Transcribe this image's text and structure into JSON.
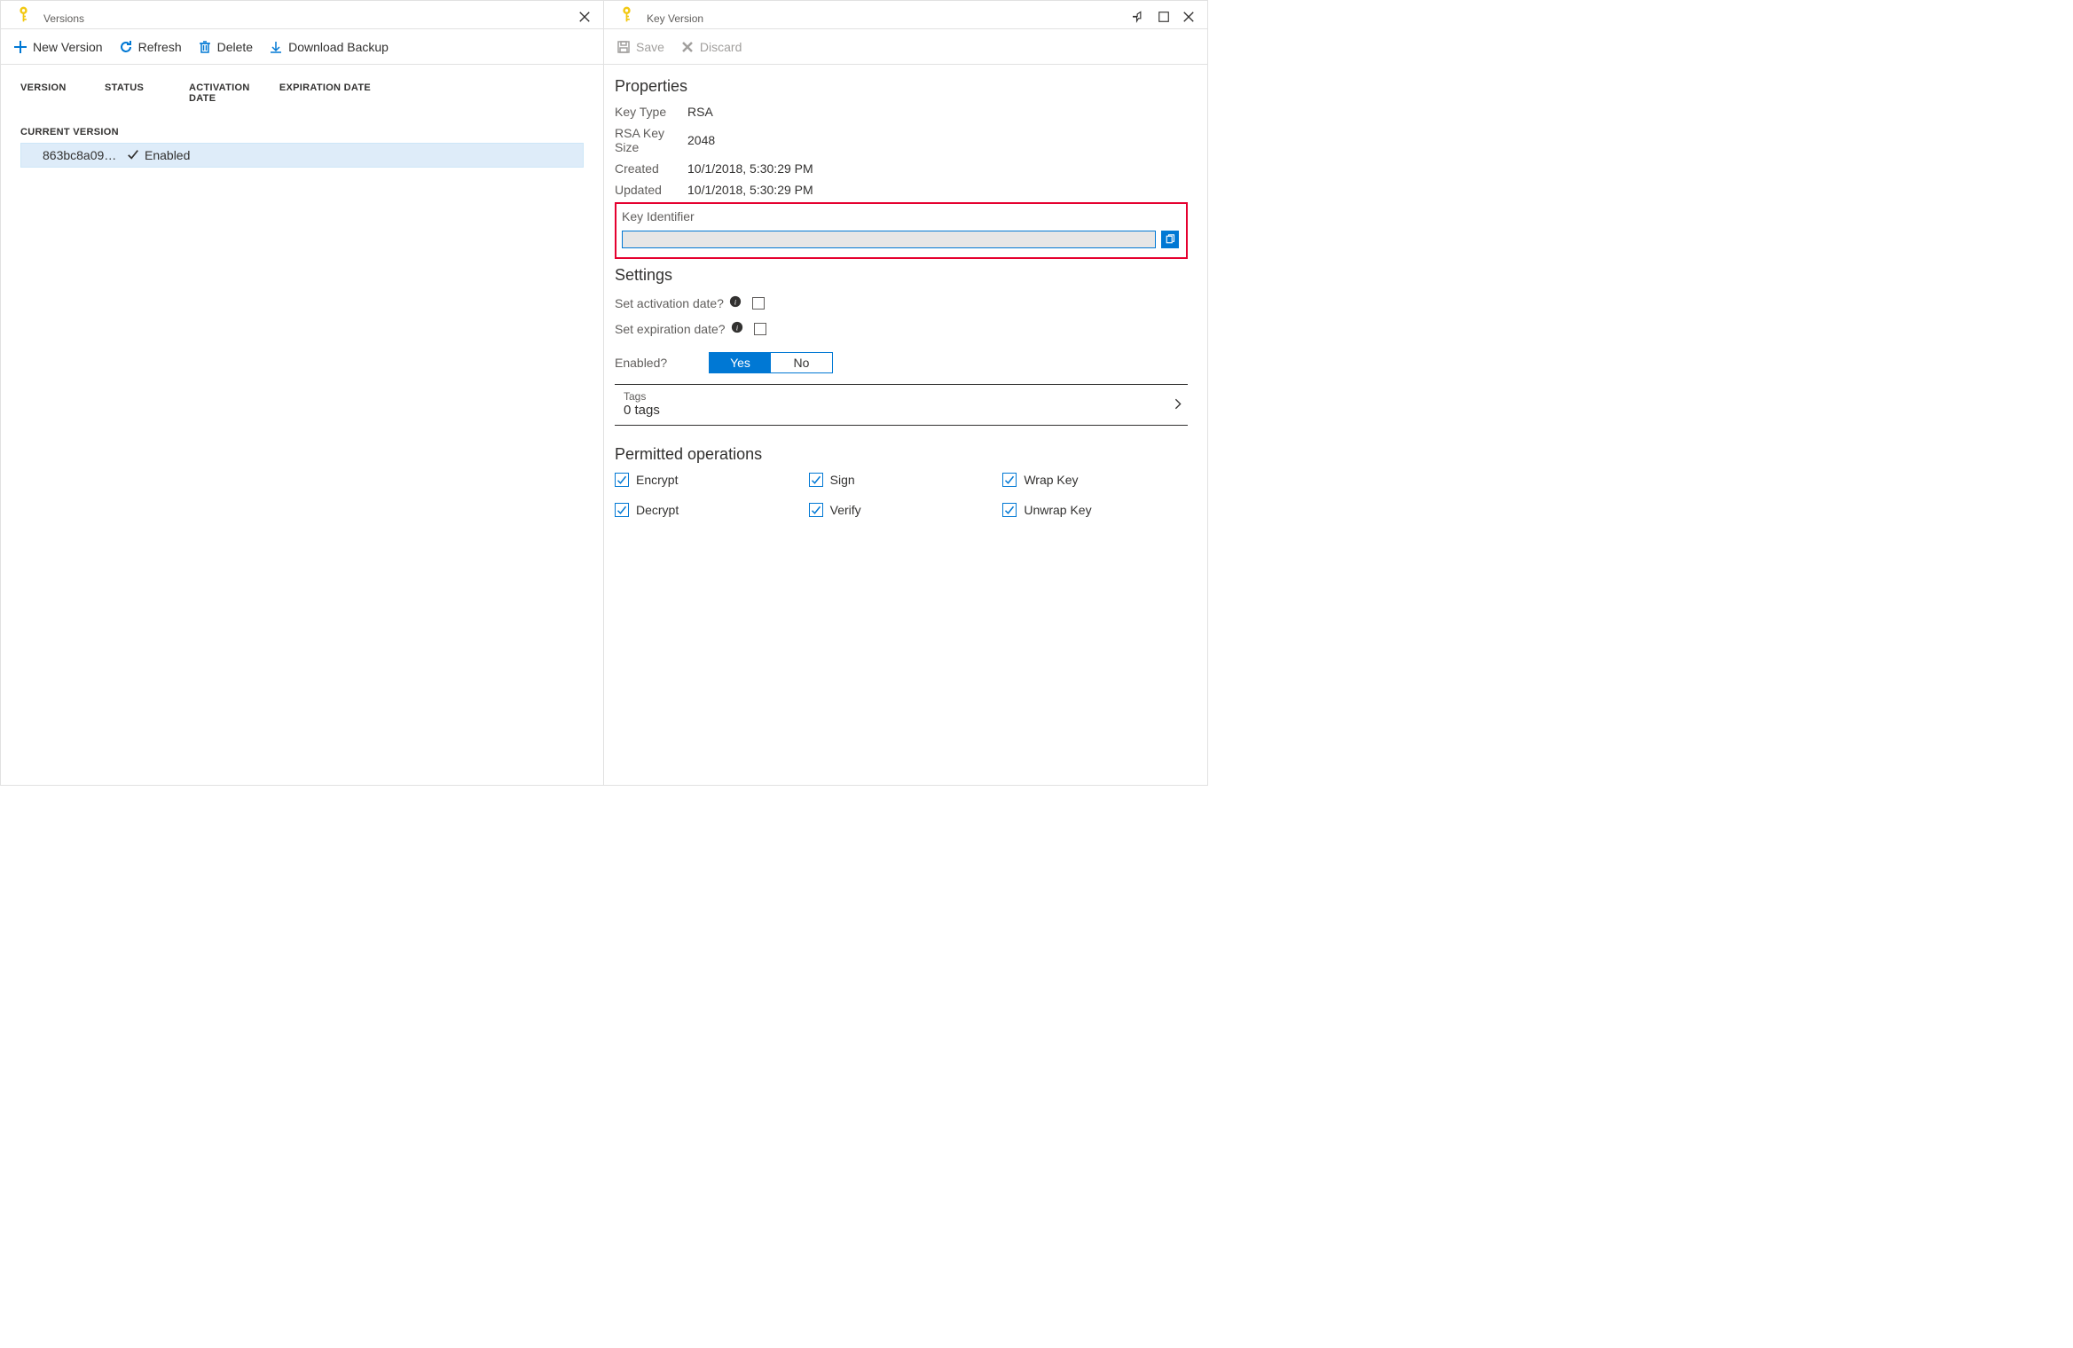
{
  "left": {
    "title": "Versions",
    "toolbar": {
      "new_version": "New Version",
      "refresh": "Refresh",
      "delete": "Delete",
      "download_backup": "Download Backup"
    },
    "columns": {
      "version": "VERSION",
      "status": "STATUS",
      "activation": "ACTIVATION DATE",
      "expiration": "EXPIRATION DATE"
    },
    "current_version_label": "CURRENT VERSION",
    "row": {
      "version": "863bc8a095044a…",
      "status": "Enabled"
    }
  },
  "right": {
    "title": "Key Version",
    "toolbar": {
      "save": "Save",
      "discard": "Discard"
    },
    "properties": {
      "heading": "Properties",
      "key_type_label": "Key Type",
      "key_type_value": "RSA",
      "rsa_size_label": "RSA Key Size",
      "rsa_size_value": "2048",
      "created_label": "Created",
      "created_value": "10/1/2018, 5:30:29 PM",
      "updated_label": "Updated",
      "updated_value": "10/1/2018, 5:30:29 PM",
      "key_identifier_label": "Key Identifier",
      "key_identifier_value": ""
    },
    "settings": {
      "heading": "Settings",
      "set_activation_label": "Set activation date?",
      "set_expiration_label": "Set expiration date?",
      "enabled_label": "Enabled?",
      "enabled_yes": "Yes",
      "enabled_no": "No",
      "tags_label": "Tags",
      "tags_value": "0 tags"
    },
    "operations": {
      "heading": "Permitted operations",
      "encrypt": "Encrypt",
      "sign": "Sign",
      "wrap": "Wrap Key",
      "decrypt": "Decrypt",
      "verify": "Verify",
      "unwrap": "Unwrap Key"
    }
  }
}
